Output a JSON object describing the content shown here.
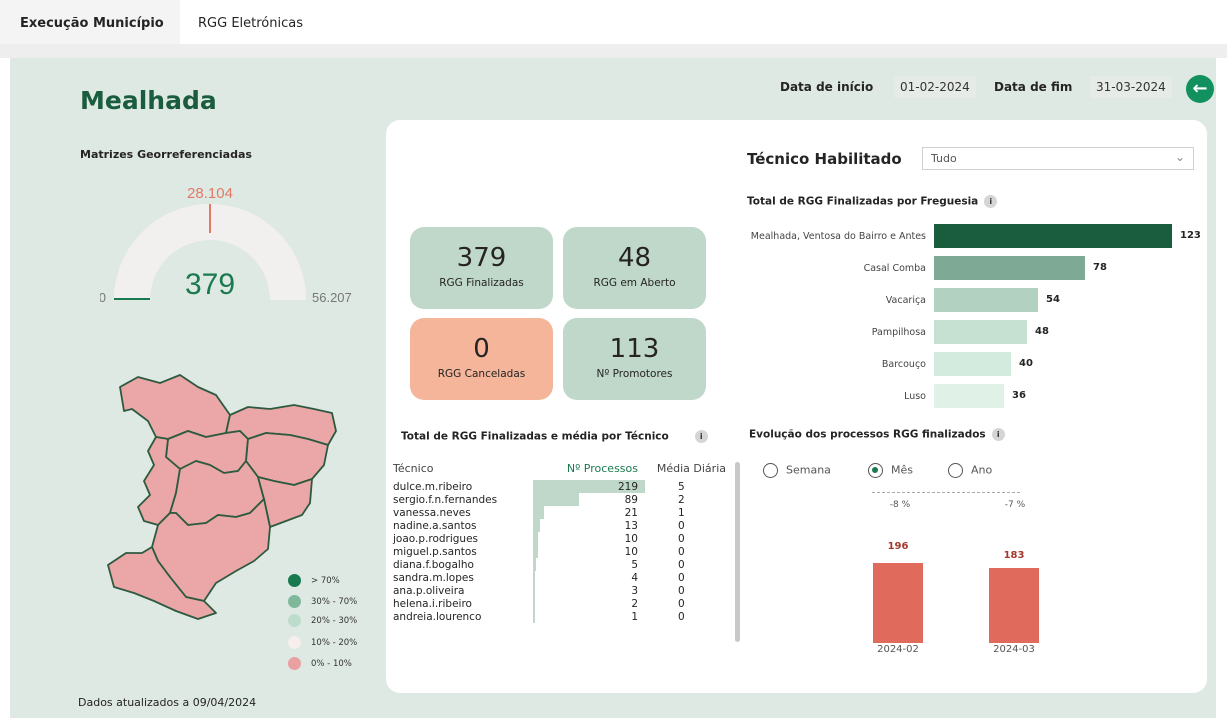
{
  "tabs": [
    {
      "label": "Execução Município"
    },
    {
      "label": "RGG Eletrónicas"
    }
  ],
  "header": {
    "city": "Mealhada",
    "start_label": "Data de início",
    "start_value": "01-02-2024",
    "end_label": "Data de fim",
    "end_value": "31-03-2024"
  },
  "gauge": {
    "title": "Matrizes Georreferenciadas",
    "target": "28.104",
    "value": "379",
    "min": "0",
    "max": "56.207",
    "value_num": 379,
    "max_num": 56207,
    "target_num": 28104
  },
  "map_legend": [
    {
      "label": "> 70%",
      "color": "#1a7a4f"
    },
    {
      "label": "30% - 70%",
      "color": "#7fb89a"
    },
    {
      "label": "20% - 30%",
      "color": "#bddccb"
    },
    {
      "label": "10% - 20%",
      "color": "#f6efee"
    },
    {
      "label": "0% - 10%",
      "color": "#e9a0a0"
    }
  ],
  "kpis": [
    {
      "value": "379",
      "label": "RGG Finalizadas"
    },
    {
      "value": "48",
      "label": "RGG em Aberto"
    },
    {
      "value": "0",
      "label": "RGG Canceladas"
    },
    {
      "value": "113",
      "label": "Nº Promotores"
    }
  ],
  "tecnico": {
    "label": "Técnico Habilitado",
    "dropdown_value": "Tudo"
  },
  "freguesia_chart": {
    "title": "Total de RGG Finalizadas por Freguesia",
    "chart_data": {
      "type": "bar",
      "categories": [
        "Mealhada, Ventosa do Bairro e Antes",
        "Casal Comba",
        "Vacariça",
        "Pampilhosa",
        "Barcouço",
        "Luso"
      ],
      "values": [
        123,
        78,
        54,
        48,
        40,
        36
      ],
      "colors": [
        "#1a5c3e",
        "#7ea995",
        "#b3d1c1",
        "#c6e0d2",
        "#d3ebde",
        "#e0f2e8"
      ]
    }
  },
  "tech_table": {
    "title": "Total de RGG Finalizadas e média por Técnico",
    "columns": [
      "Técnico",
      "Nº Processos",
      "Média Diária"
    ],
    "rows": [
      {
        "name": "dulce.m.ribeiro",
        "proc": "219",
        "media": "5",
        "n": 219
      },
      {
        "name": "sergio.f.n.fernandes",
        "proc": "89",
        "media": "2",
        "n": 89
      },
      {
        "name": "vanessa.neves",
        "proc": "21",
        "media": "1",
        "n": 21
      },
      {
        "name": "nadine.a.santos",
        "proc": "13",
        "media": "0",
        "n": 13
      },
      {
        "name": "joao.p.rodrigues",
        "proc": "10",
        "media": "0",
        "n": 10
      },
      {
        "name": "miguel.p.santos",
        "proc": "10",
        "media": "0",
        "n": 10
      },
      {
        "name": "diana.f.bogalho",
        "proc": "5",
        "media": "0",
        "n": 5
      },
      {
        "name": "sandra.m.lopes",
        "proc": "4",
        "media": "0",
        "n": 4
      },
      {
        "name": "ana.p.oliveira",
        "proc": "3",
        "media": "0",
        "n": 3
      },
      {
        "name": "helena.i.ribeiro",
        "proc": "2",
        "media": "0",
        "n": 2
      },
      {
        "name": "andreia.lourenco",
        "proc": "1",
        "media": "0",
        "n": 1
      }
    ]
  },
  "evolucao": {
    "title": "Evolução dos processos RGG finalizados",
    "radios": [
      {
        "label": "Semana",
        "selected": false
      },
      {
        "label": "Mês",
        "selected": true
      },
      {
        "label": "Ano",
        "selected": false
      }
    ],
    "pct_changes": [
      "-8 %",
      "-7 %"
    ],
    "chart_data": {
      "type": "bar",
      "categories": [
        "2024-02",
        "2024-03"
      ],
      "values": [
        196,
        183
      ]
    },
    "value_labels": [
      "196",
      "183"
    ]
  },
  "footer": "Dados atualizados a 09/04/2024",
  "colors": {
    "accent": "#12915f",
    "bg": "#dfe9e4",
    "dark_green": "#1a5c3e",
    "bar_red": "#e06a5c"
  }
}
